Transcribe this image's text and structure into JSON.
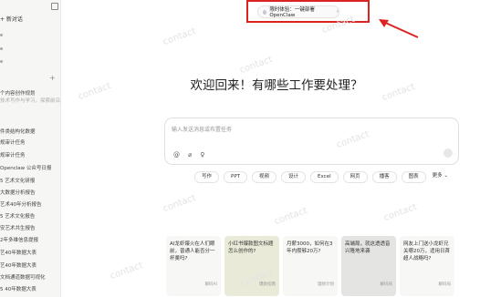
{
  "sidebar": {
    "new_chat": "+ 新对话",
    "items": [
      {
        "label": "个内容创作规划"
      },
      {
        "label": "技术写作与学习，探索前沿",
        "muted": true
      },
      {
        "label": "件类结构化数据"
      },
      {
        "label": "规审计任务"
      },
      {
        "label": "规审计任务"
      },
      {
        "label": "Openclaw 公众号日报"
      },
      {
        "label": "5 艺术文化研报"
      },
      {
        "label": "大数据分析报告"
      },
      {
        "label": "艺术40年分析报告"
      },
      {
        "label": "5 艺术文化报告"
      },
      {
        "label": "安艺术共生报告"
      },
      {
        "label": "2年多维信息提报"
      },
      {
        "label": "艺40年数据大表"
      },
      {
        "label": "艺40年数据大表"
      },
      {
        "label": "文档通道数据可视化"
      },
      {
        "label": "5 40年数据大表"
      },
      {
        "label": "-40年数据大表"
      }
    ]
  },
  "banner": {
    "label": "限时体验：一键部署 OpenClaw"
  },
  "heading": "欢迎回来！有哪些工作要处理？",
  "input": {
    "placeholder": "输入发送消息或布置任务"
  },
  "chips": [
    "写作",
    "PPT",
    "视频",
    "设计",
    "Excel",
    "网页",
    "播客",
    "图表",
    "更多 ⌄"
  ],
  "cards": [
    {
      "text": "AI龙虾爆火在人们眼前，普通人能否分一杯羹吗?",
      "tag": "解码AI"
    },
    {
      "text": "小红书爆款图文标题怎么创作的?",
      "tag": "爆款指南"
    },
    {
      "text": "月薪3000，如何在3年内攒够20万?",
      "tag": "理财计划"
    },
    {
      "text": "高端局，就这透透音兴隆地来袭",
      "tag": "解码局"
    },
    {
      "text": "网友上门送小龙虾兄关哪20万，适用日首超人战略吗?",
      "tag": "解码局"
    }
  ],
  "watermark": "contact"
}
